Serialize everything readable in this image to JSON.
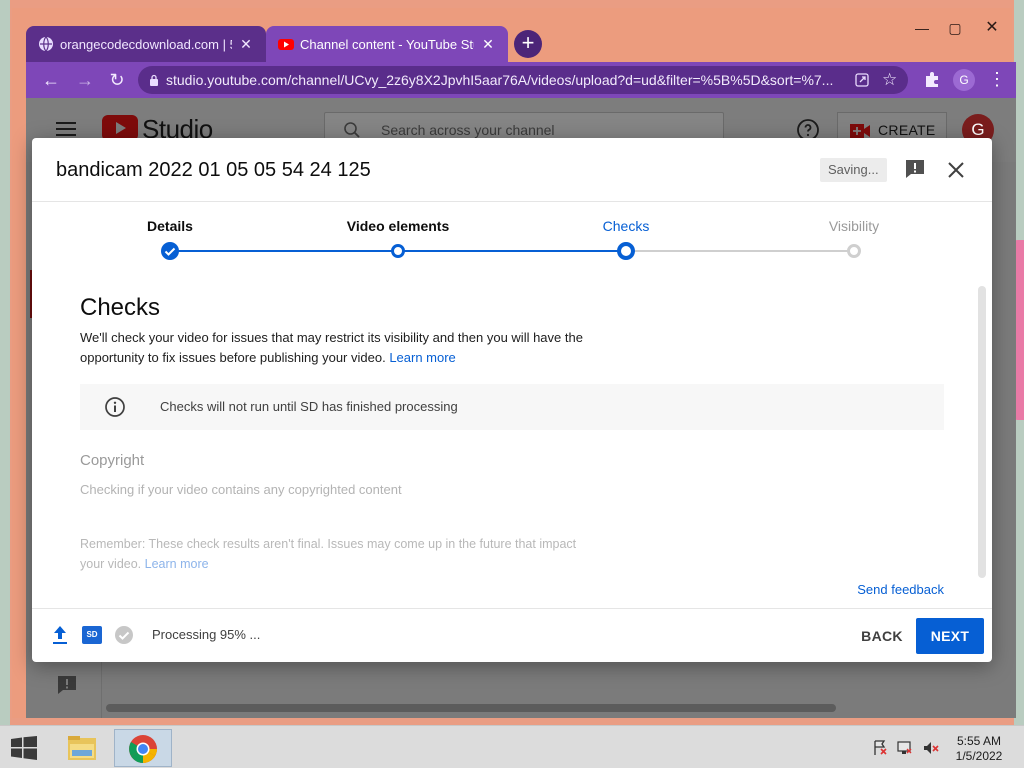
{
  "browser": {
    "tabs": [
      {
        "title": "orangecodecdownload.com | 52..."
      },
      {
        "title": "Channel content - YouTube Studio"
      }
    ],
    "new_tab_label": "+",
    "url": "studio.youtube.com/channel/UCvy_2z6y8X2JpvhI5aar76A/videos/upload?d=ud&filter=%5B%5D&sort=%7...",
    "profile_initial": "G"
  },
  "studio": {
    "logo_text": "Studio",
    "search_placeholder": "Search across your channel",
    "create_label": "CREATE",
    "avatar_initial": "G"
  },
  "dialog": {
    "title": "bandicam 2022 01 05 05 54 24 125",
    "saving_label": "Saving...",
    "steps": [
      {
        "label": "Details",
        "state": "done"
      },
      {
        "label": "Video elements",
        "state": "visited"
      },
      {
        "label": "Checks",
        "state": "current"
      },
      {
        "label": "Visibility",
        "state": "todo"
      }
    ],
    "heading": "Checks",
    "description": "We'll check your video for issues that may restrict its visibility and then you will have the opportunity to fix issues before publishing your video.",
    "learn_more": "Learn more",
    "info_message": "Checks will not run until SD has finished processing",
    "copyright_title": "Copyright",
    "copyright_desc": "Checking if your video contains any copyrighted content",
    "remember_text": "Remember: These check results aren't final. Issues may come up in the future that impact your video.",
    "remember_link": "Learn more",
    "send_feedback": "Send feedback",
    "sd_badge": "SD",
    "processing_status": "Processing 95% ...",
    "back_label": "BACK",
    "next_label": "NEXT"
  },
  "taskbar": {
    "time": "5:55 AM",
    "date": "1/5/2022"
  },
  "colors": {
    "accent_blue": "#065fd4",
    "browser_purple": "#7e47b8",
    "yt_red": "#ff0000"
  }
}
